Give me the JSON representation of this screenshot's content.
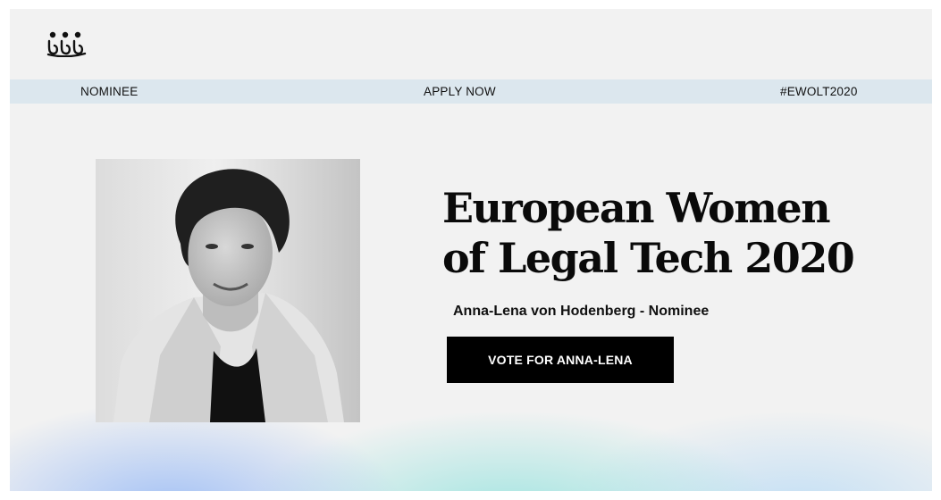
{
  "nav": {
    "items": [
      "NOMINEE",
      "APPLY NOW",
      "#EWOLT2020"
    ]
  },
  "logo": {
    "icon": "ewolt-logo-icon"
  },
  "hero": {
    "headline_line1": "European Women",
    "headline_line2": "of Legal Tech 2020",
    "subtitle": "Anna-Lena von Hodenberg - Nominee",
    "button_label": "VOTE FOR ANNA-LENA",
    "photo_icon": "nominee-portrait"
  },
  "colors": {
    "background": "#f2f2f2",
    "navbar": "#dce7ee",
    "button": "#000000",
    "button_text": "#ffffff",
    "glow_blue": "#96b9f5",
    "glow_teal": "#8ce1dc"
  }
}
